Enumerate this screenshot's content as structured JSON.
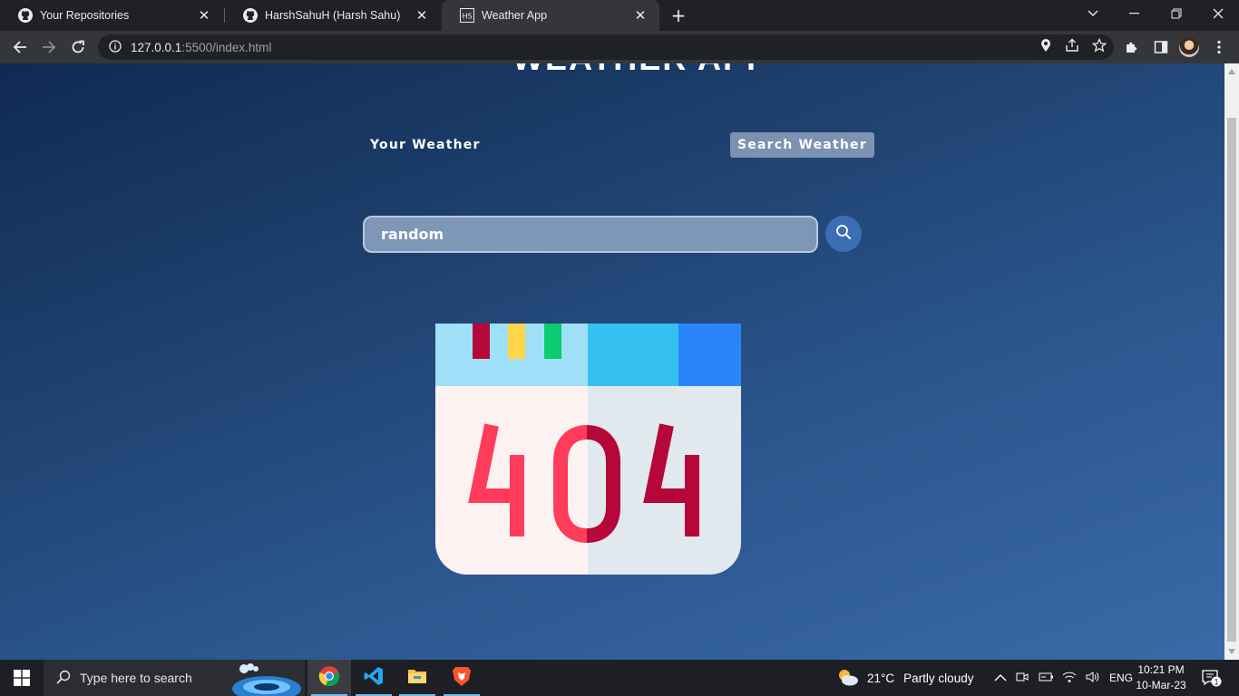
{
  "browser": {
    "tabs": [
      {
        "title": "Your Repositories",
        "favicon": "github-icon"
      },
      {
        "title": "HarshSahuH (Harsh Sahu)",
        "favicon": "github-icon"
      },
      {
        "title": "Weather App",
        "favicon": "hs-logo-icon",
        "active": true
      }
    ],
    "url_host": "127.0.0.1",
    "url_path": ":5500/index.html"
  },
  "page": {
    "app_title": "WEATHER APP",
    "tab_your_weather": "Your Weather",
    "tab_search_weather": "Search Weather",
    "search_value": "random",
    "error_image_text": "404"
  },
  "taskbar": {
    "search_placeholder": "Type here to search",
    "weather_temp": "21°C",
    "weather_desc": "Partly cloudy",
    "lang": "ENG",
    "time": "10:21 PM",
    "date": "10-Mar-23",
    "notification_count": "1"
  },
  "colors": {
    "page_gradient_start": "#0f2a52",
    "page_gradient_end": "#3a6aa7",
    "search_input_bg": "#7f97b6",
    "search_button_bg": "#3d6db2",
    "calendar_red": "#ff3d5a",
    "calendar_dark_red": "#b5073a"
  }
}
